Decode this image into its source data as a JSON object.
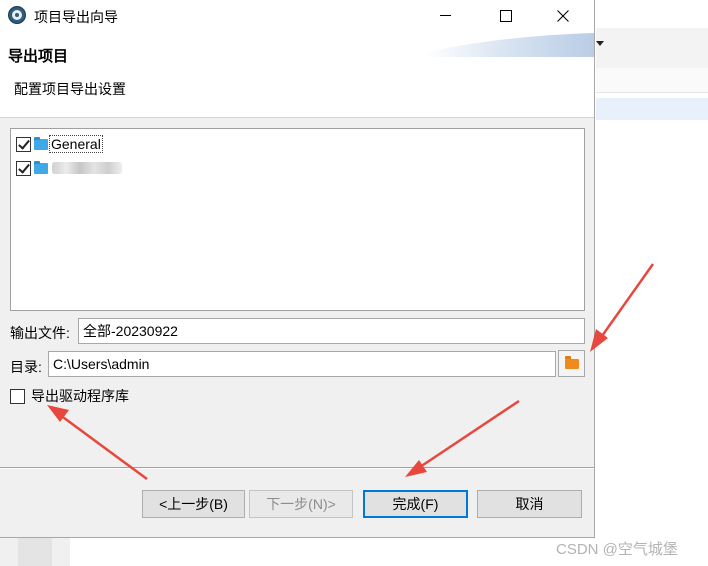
{
  "window": {
    "title": "项目导出向导"
  },
  "header": {
    "title": "导出项目",
    "subtitle": "配置项目导出设置"
  },
  "tree": {
    "items": [
      {
        "label": "General",
        "checked": true,
        "icon": "folder-icon"
      },
      {
        "label": "",
        "checked": true,
        "icon": "folder-icon",
        "note_blurred": true
      }
    ]
  },
  "fields": {
    "file_label": "输出文件:",
    "file_value": "全部-20230922",
    "dir_label": "目录:",
    "dir_value": "C:\\Users\\admin"
  },
  "options": {
    "export_driver_label": "导出驱动程序库",
    "export_driver_checked": false
  },
  "buttons": {
    "back": "<上一步(B)",
    "next": "下一步(N)>",
    "finish": "完成(F)",
    "cancel": "取消"
  },
  "watermark": "CSDN @空气城堡",
  "colors": {
    "accent": "#0078d7",
    "folder_blue": "#3fa9e8",
    "folder_orange": "#f08a1c",
    "annotation_arrow": "#e8473d"
  }
}
